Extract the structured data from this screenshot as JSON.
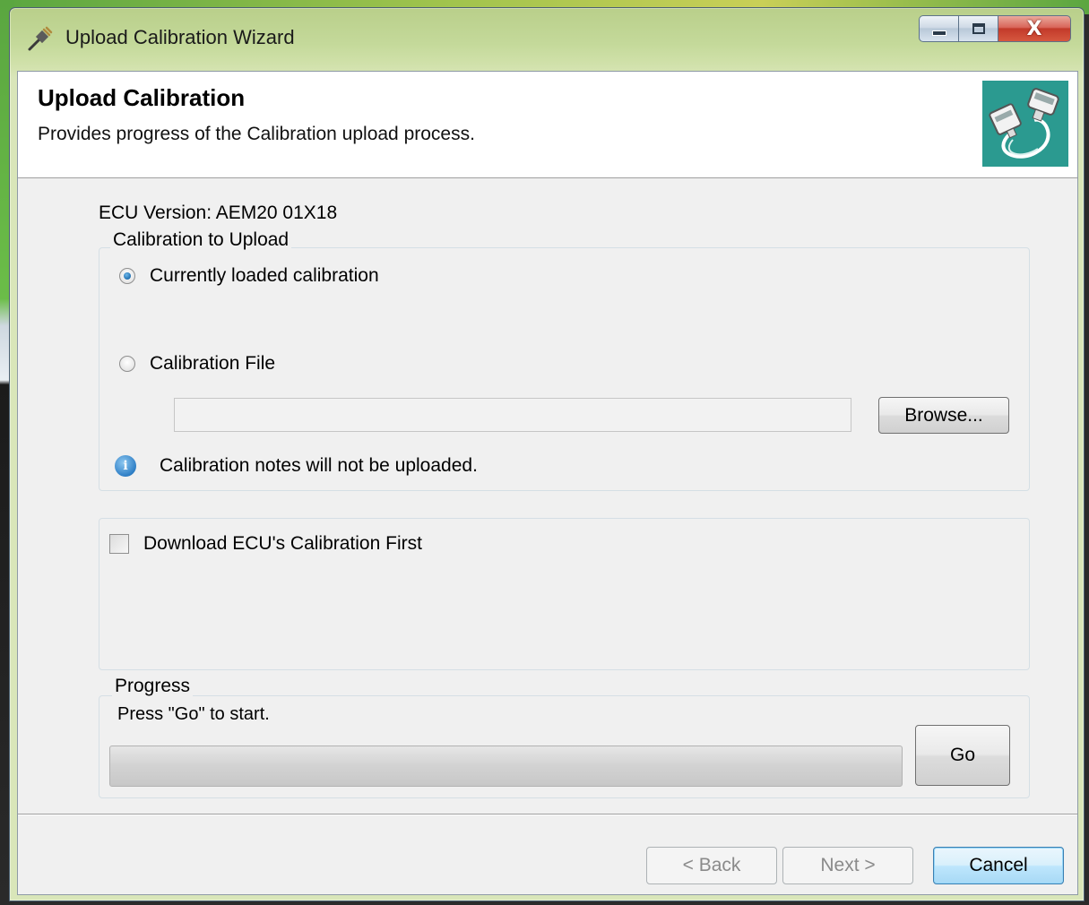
{
  "window": {
    "title": "Upload Calibration Wizard",
    "close_glyph": "X",
    "icons": {
      "app": "plug-icon",
      "minimize": "minimize-icon",
      "maximize": "maximize-icon",
      "close": "close-icon"
    }
  },
  "header": {
    "title": "Upload Calibration",
    "subtitle": "Provides progress of the Calibration upload process.",
    "logo_icon": "cable-connector-icon",
    "logo_color": "#2b9a90"
  },
  "ecu_version": "ECU Version: AEM20 01X18",
  "calibration_group": {
    "legend": "Calibration to Upload",
    "options": [
      {
        "label": "Currently loaded calibration",
        "selected": true
      },
      {
        "label": "Calibration File",
        "selected": false
      }
    ],
    "file_path_value": "",
    "browse_label": "Browse...",
    "info_icon": "info-icon",
    "info_text": "Calibration notes will not be uploaded."
  },
  "download_option": {
    "label": "Download ECU's Calibration First",
    "checked": false
  },
  "progress_group": {
    "legend": "Progress",
    "status": "Press \"Go\" to start.",
    "value_percent": 0,
    "go_label": "Go"
  },
  "footer": {
    "back_label": "< Back",
    "next_label": "Next >",
    "cancel_label": "Cancel"
  }
}
